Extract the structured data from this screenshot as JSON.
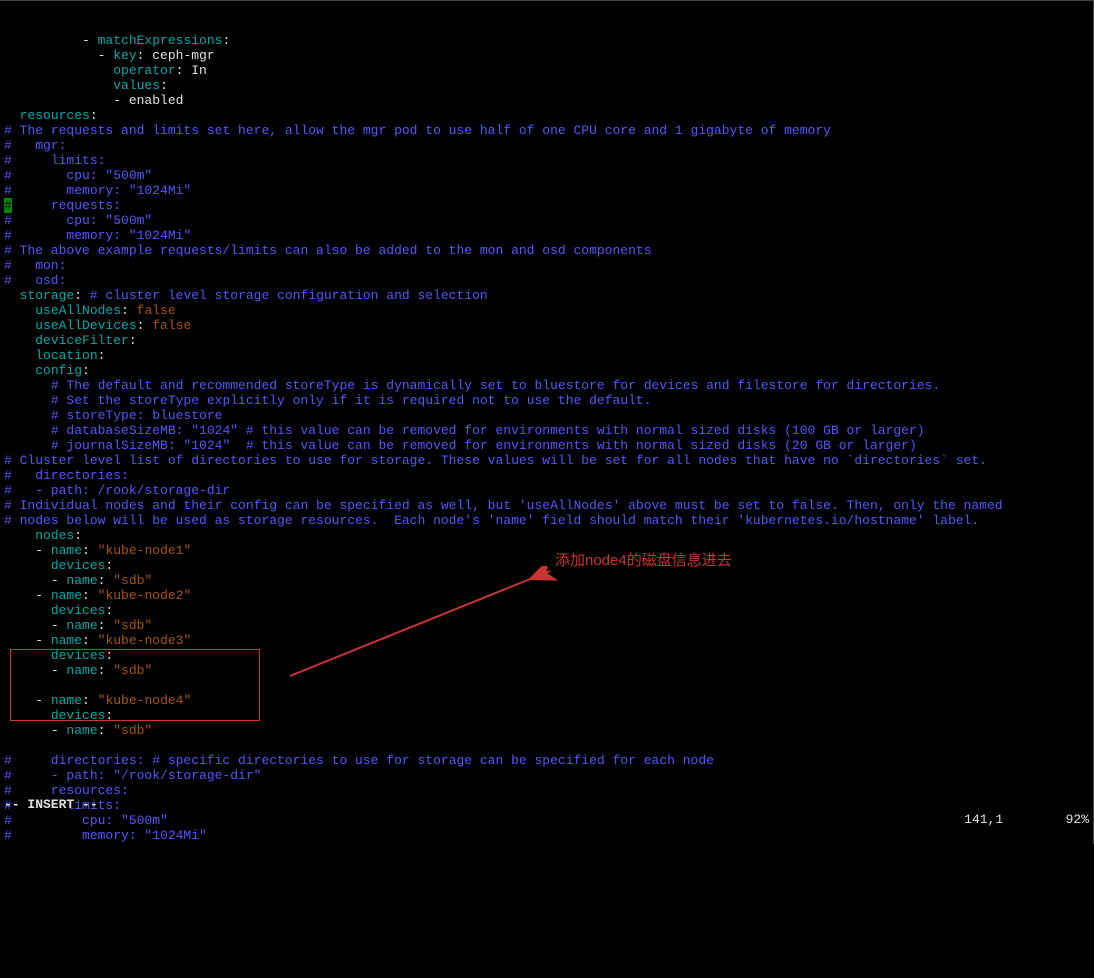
{
  "editor": {
    "lines": [
      {
        "indent": "          ",
        "tokens": [
          {
            "t": "dash",
            "s": "- "
          },
          {
            "t": "key",
            "s": "matchExpressions"
          },
          {
            "t": "plain",
            "s": ":"
          }
        ]
      },
      {
        "indent": "            ",
        "tokens": [
          {
            "t": "dash",
            "s": "- "
          },
          {
            "t": "key",
            "s": "key"
          },
          {
            "t": "plain",
            "s": ": "
          },
          {
            "t": "plain",
            "s": "ceph-mgr"
          }
        ]
      },
      {
        "indent": "              ",
        "tokens": [
          {
            "t": "key",
            "s": "operator"
          },
          {
            "t": "plain",
            "s": ": "
          },
          {
            "t": "plain",
            "s": "In"
          }
        ]
      },
      {
        "indent": "              ",
        "tokens": [
          {
            "t": "key",
            "s": "values"
          },
          {
            "t": "plain",
            "s": ":"
          }
        ]
      },
      {
        "indent": "              ",
        "tokens": [
          {
            "t": "dash",
            "s": "- "
          },
          {
            "t": "plain",
            "s": "enabled"
          }
        ]
      },
      {
        "indent": "  ",
        "tokens": [
          {
            "t": "key",
            "s": "resources"
          },
          {
            "t": "plain",
            "s": ":"
          }
        ]
      },
      {
        "indent": "",
        "tokens": [
          {
            "t": "com",
            "s": "# The requests and limits set here, allow the mgr pod to use half of one CPU core and 1 gigabyte of memory"
          }
        ]
      },
      {
        "indent": "",
        "tokens": [
          {
            "t": "com",
            "s": "#   mgr:"
          }
        ]
      },
      {
        "indent": "",
        "tokens": [
          {
            "t": "com",
            "s": "#     limits:"
          }
        ]
      },
      {
        "indent": "",
        "tokens": [
          {
            "t": "com",
            "s": "#       cpu: \"500m\""
          }
        ]
      },
      {
        "indent": "",
        "tokens": [
          {
            "t": "com",
            "s": "#       memory: \"1024Mi\""
          }
        ]
      },
      {
        "indent": "",
        "tokens": [
          {
            "t": "cursor",
            "s": "#"
          },
          {
            "t": "com",
            "s": "     requests:"
          }
        ]
      },
      {
        "indent": "",
        "tokens": [
          {
            "t": "com",
            "s": "#       cpu: \"500m\""
          }
        ]
      },
      {
        "indent": "",
        "tokens": [
          {
            "t": "com",
            "s": "#       memory: \"1024Mi\""
          }
        ]
      },
      {
        "indent": "",
        "tokens": [
          {
            "t": "com",
            "s": "# The above example requests/limits can also be added to the mon and osd components"
          }
        ]
      },
      {
        "indent": "",
        "tokens": [
          {
            "t": "com",
            "s": "#   mon:"
          }
        ]
      },
      {
        "indent": "",
        "tokens": [
          {
            "t": "com",
            "s": "#   osd:"
          }
        ]
      },
      {
        "indent": "  ",
        "tokens": [
          {
            "t": "key",
            "s": "storage"
          },
          {
            "t": "plain",
            "s": ": "
          },
          {
            "t": "com",
            "s": "# cluster level storage configuration and selection"
          }
        ]
      },
      {
        "indent": "    ",
        "tokens": [
          {
            "t": "key",
            "s": "useAllNodes"
          },
          {
            "t": "plain",
            "s": ": "
          },
          {
            "t": "val",
            "s": "false"
          }
        ]
      },
      {
        "indent": "    ",
        "tokens": [
          {
            "t": "key",
            "s": "useAllDevices"
          },
          {
            "t": "plain",
            "s": ": "
          },
          {
            "t": "val",
            "s": "false"
          }
        ]
      },
      {
        "indent": "    ",
        "tokens": [
          {
            "t": "key",
            "s": "deviceFilter"
          },
          {
            "t": "plain",
            "s": ":"
          }
        ]
      },
      {
        "indent": "    ",
        "tokens": [
          {
            "t": "key",
            "s": "location"
          },
          {
            "t": "plain",
            "s": ":"
          }
        ]
      },
      {
        "indent": "    ",
        "tokens": [
          {
            "t": "key",
            "s": "config"
          },
          {
            "t": "plain",
            "s": ":"
          }
        ]
      },
      {
        "indent": "      ",
        "tokens": [
          {
            "t": "com",
            "s": "# The default and recommended storeType is dynamically set to bluestore for devices and filestore for directories."
          }
        ]
      },
      {
        "indent": "      ",
        "tokens": [
          {
            "t": "com",
            "s": "# Set the storeType explicitly only if it is required not to use the default."
          }
        ]
      },
      {
        "indent": "      ",
        "tokens": [
          {
            "t": "com",
            "s": "# storeType: bluestore"
          }
        ]
      },
      {
        "indent": "      ",
        "tokens": [
          {
            "t": "com",
            "s": "# databaseSizeMB: \"1024\" # this value can be removed for environments with normal sized disks (100 GB or larger)"
          }
        ]
      },
      {
        "indent": "      ",
        "tokens": [
          {
            "t": "com",
            "s": "# journalSizeMB: \"1024\"  # this value can be removed for environments with normal sized disks (20 GB or larger)"
          }
        ]
      },
      {
        "indent": "",
        "tokens": [
          {
            "t": "com",
            "s": "# Cluster level list of directories to use for storage. These values will be set for all nodes that have no `directories` set."
          }
        ]
      },
      {
        "indent": "",
        "tokens": [
          {
            "t": "com",
            "s": "#   directories:"
          }
        ]
      },
      {
        "indent": "",
        "tokens": [
          {
            "t": "com",
            "s": "#   - path: /rook/storage-dir"
          }
        ]
      },
      {
        "indent": "",
        "tokens": [
          {
            "t": "com",
            "s": "# Individual nodes and their config can be specified as well, but 'useAllNodes' above must be set to false. Then, only the named"
          }
        ]
      },
      {
        "indent": "",
        "tokens": [
          {
            "t": "com",
            "s": "# nodes below will be used as storage resources.  Each node's 'name' field should match their 'kubernetes.io/hostname' label."
          }
        ]
      },
      {
        "indent": "    ",
        "tokens": [
          {
            "t": "key",
            "s": "nodes"
          },
          {
            "t": "plain",
            "s": ":"
          }
        ]
      },
      {
        "indent": "    ",
        "tokens": [
          {
            "t": "dash",
            "s": "- "
          },
          {
            "t": "key",
            "s": "name"
          },
          {
            "t": "plain",
            "s": ": "
          },
          {
            "t": "val",
            "s": "\"kube-node1\""
          }
        ]
      },
      {
        "indent": "      ",
        "tokens": [
          {
            "t": "key",
            "s": "devices"
          },
          {
            "t": "plain",
            "s": ":"
          }
        ]
      },
      {
        "indent": "      ",
        "tokens": [
          {
            "t": "dash",
            "s": "- "
          },
          {
            "t": "key",
            "s": "name"
          },
          {
            "t": "plain",
            "s": ": "
          },
          {
            "t": "val",
            "s": "\"sdb\""
          }
        ]
      },
      {
        "indent": "    ",
        "tokens": [
          {
            "t": "dash",
            "s": "- "
          },
          {
            "t": "key",
            "s": "name"
          },
          {
            "t": "plain",
            "s": ": "
          },
          {
            "t": "val",
            "s": "\"kube-node2\""
          }
        ]
      },
      {
        "indent": "      ",
        "tokens": [
          {
            "t": "key",
            "s": "devices"
          },
          {
            "t": "plain",
            "s": ":"
          }
        ]
      },
      {
        "indent": "      ",
        "tokens": [
          {
            "t": "dash",
            "s": "- "
          },
          {
            "t": "key",
            "s": "name"
          },
          {
            "t": "plain",
            "s": ": "
          },
          {
            "t": "val",
            "s": "\"sdb\""
          }
        ]
      },
      {
        "indent": "    ",
        "tokens": [
          {
            "t": "dash",
            "s": "- "
          },
          {
            "t": "key",
            "s": "name"
          },
          {
            "t": "plain",
            "s": ": "
          },
          {
            "t": "val",
            "s": "\"kube-node3\""
          }
        ]
      },
      {
        "indent": "      ",
        "tokens": [
          {
            "t": "key",
            "s": "devices"
          },
          {
            "t": "plain",
            "s": ":"
          }
        ]
      },
      {
        "indent": "      ",
        "tokens": [
          {
            "t": "dash",
            "s": "- "
          },
          {
            "t": "key",
            "s": "name"
          },
          {
            "t": "plain",
            "s": ": "
          },
          {
            "t": "val",
            "s": "\"sdb\""
          }
        ]
      },
      {
        "indent": "",
        "tokens": []
      },
      {
        "indent": "    ",
        "tokens": [
          {
            "t": "dash",
            "s": "- "
          },
          {
            "t": "key",
            "s": "name"
          },
          {
            "t": "plain",
            "s": ": "
          },
          {
            "t": "val",
            "s": "\"kube-node4\""
          }
        ]
      },
      {
        "indent": "      ",
        "tokens": [
          {
            "t": "key",
            "s": "devices"
          },
          {
            "t": "plain",
            "s": ":"
          }
        ]
      },
      {
        "indent": "      ",
        "tokens": [
          {
            "t": "dash",
            "s": "- "
          },
          {
            "t": "key",
            "s": "name"
          },
          {
            "t": "plain",
            "s": ": "
          },
          {
            "t": "val",
            "s": "\"sdb\""
          }
        ]
      },
      {
        "indent": "",
        "tokens": []
      },
      {
        "indent": "",
        "tokens": [
          {
            "t": "com",
            "s": "#     directories: # specific directories to use for storage can be specified for each node"
          }
        ]
      },
      {
        "indent": "",
        "tokens": [
          {
            "t": "com",
            "s": "#     - path: \"/rook/storage-dir\""
          }
        ]
      },
      {
        "indent": "",
        "tokens": [
          {
            "t": "com",
            "s": "#     resources:"
          }
        ]
      },
      {
        "indent": "",
        "tokens": [
          {
            "t": "com",
            "s": "#       limits:"
          }
        ]
      },
      {
        "indent": "",
        "tokens": [
          {
            "t": "com",
            "s": "#         cpu: \"500m\""
          }
        ]
      },
      {
        "indent": "",
        "tokens": [
          {
            "t": "com",
            "s": "#         memory: \"1024Mi\""
          }
        ]
      }
    ]
  },
  "status": {
    "mode": "-- INSERT --",
    "pos": "141,1",
    "pct": "92%"
  },
  "annotation": {
    "label": "添加node4的磁盘信息进去"
  }
}
